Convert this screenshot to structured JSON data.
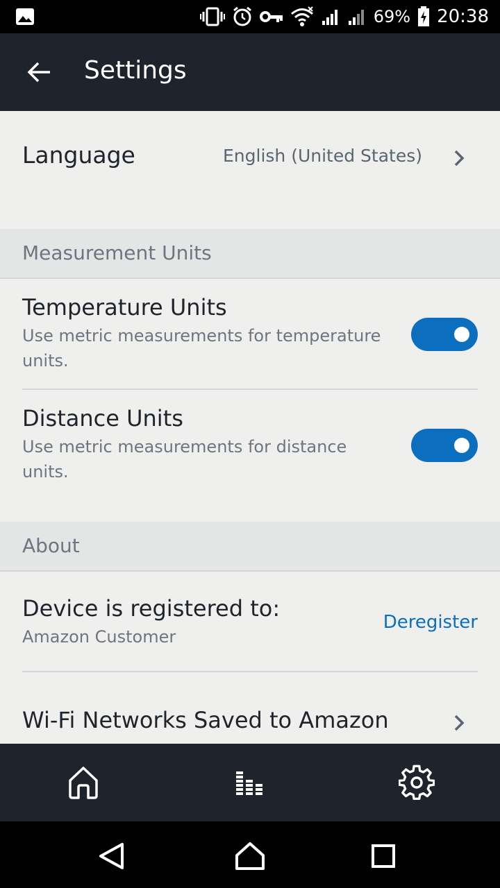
{
  "status_bar": {
    "battery_percent": "69%",
    "time": "20:38",
    "icons": [
      "image-icon",
      "vibrate-icon",
      "alarm-icon",
      "vpn-key-icon",
      "wifi-icon",
      "signal-icon",
      "signal-icon",
      "battery-charging-icon"
    ]
  },
  "app_bar": {
    "title": "Settings",
    "back_icon": "arrow-back-icon"
  },
  "language": {
    "label": "Language",
    "value": "English (United States)"
  },
  "measurement_section": {
    "header": "Measurement Units",
    "items": [
      {
        "title": "Temperature Units",
        "description": "Use metric measurements for temperature units.",
        "enabled": true
      },
      {
        "title": "Distance Units",
        "description": "Use metric measurements for distance units.",
        "enabled": true
      }
    ]
  },
  "about_section": {
    "header": "About",
    "registered_label": "Device is registered to:",
    "registered_value": "Amazon Customer",
    "deregister_label": "Deregister",
    "wifi_networks_label": "Wi-Fi Networks Saved to Amazon"
  },
  "bottom_nav": {
    "items": [
      "home-icon",
      "equalizer-icon",
      "gear-icon"
    ]
  },
  "colors": {
    "accent": "#0b6ebf",
    "app_bar": "#1f232b",
    "background": "#efefee",
    "section_header": "#e4e5e5"
  }
}
